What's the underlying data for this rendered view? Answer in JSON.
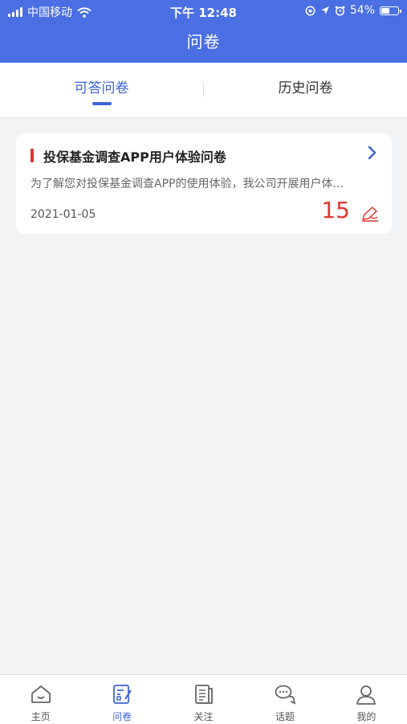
{
  "status_bar": {
    "carrier": "中国移动",
    "time": "下午 12:48",
    "battery": "54%",
    "battery_level": 0.54
  },
  "header": {
    "title": "问卷"
  },
  "tabs": [
    {
      "label": "可答问卷",
      "active": true
    },
    {
      "label": "历史问卷",
      "active": false
    }
  ],
  "survey_card": {
    "title": "投保基金调查APP用户体验问卷",
    "description": "为了解您对投保基金调查APP的使用体验，我公司开展用户体...",
    "date": "2021-01-05",
    "count": "15",
    "icons": [
      "chevron-right-icon",
      "pen-icon"
    ]
  },
  "bottom_nav": [
    {
      "label": "主页",
      "icon": "home-icon",
      "active": false
    },
    {
      "label": "问卷",
      "icon": "survey-icon",
      "active": true
    },
    {
      "label": "关注",
      "icon": "news-icon",
      "active": false
    },
    {
      "label": "话题",
      "icon": "chat-icon",
      "active": false
    },
    {
      "label": "我的",
      "icon": "user-icon",
      "active": false
    }
  ],
  "colors": {
    "primary": "#4a6fe3",
    "accent": "#3f64d8",
    "alert": "#e2352e",
    "background": "#f2f3f5"
  }
}
